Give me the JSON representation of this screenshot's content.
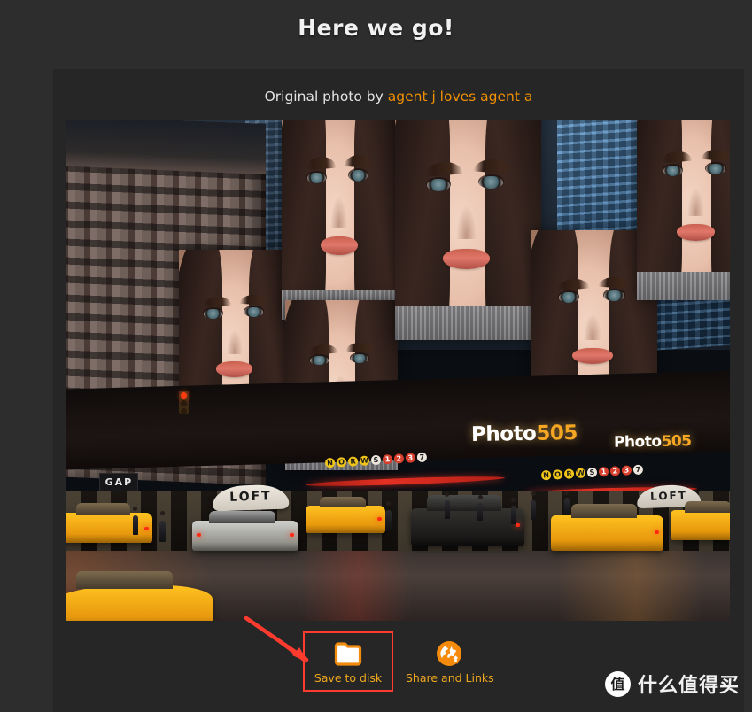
{
  "page": {
    "title": "Here we go!",
    "background_color": "#2d2d2d",
    "panel_color": "#262626"
  },
  "attribution": {
    "prefix": "Original photo by ",
    "author": "agent j loves agent a",
    "author_color": "#f29100"
  },
  "photo": {
    "alt": "Times Square street scene at dusk with large billboards of a woman's face, yellow taxis and wet road",
    "signs": {
      "marquee_primary_text": "Photo",
      "marquee_primary_number": "505",
      "marquee_secondary_text": "Photo",
      "marquee_secondary_number": "505",
      "subway_letters": [
        "N",
        "O",
        "R",
        "W",
        "S"
      ],
      "subway_numbers": [
        "1",
        "2",
        "3",
        "7"
      ],
      "store_gap": "GAP",
      "store_loft": "LOFT",
      "store_loft_2": "LOFT"
    }
  },
  "actions": {
    "save": {
      "label": "Save to disk",
      "icon": "folder-icon",
      "highlighted": true,
      "highlight_color": "#ff3b30"
    },
    "share": {
      "label": "Share and Links",
      "icon": "globe-share-icon"
    },
    "label_color": "#f0a81e",
    "icon_color": "#f28c0f"
  },
  "annotation": {
    "arrow_color": "#ff3b30",
    "points_to": "Save to disk"
  },
  "watermark": {
    "logo_char": "值",
    "text": "什么值得买"
  }
}
